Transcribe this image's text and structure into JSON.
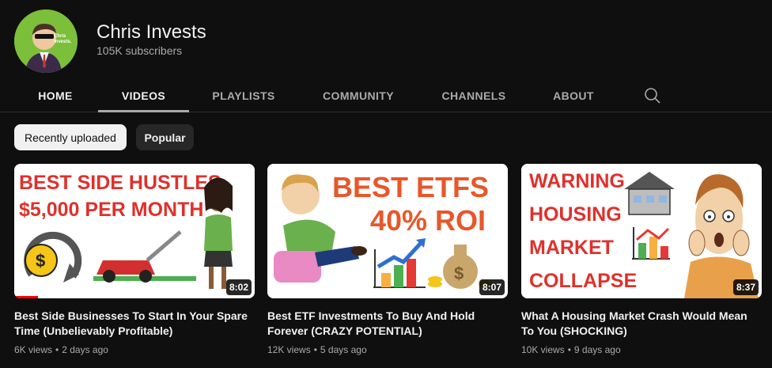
{
  "channel": {
    "name": "Chris Invests",
    "subscribers": "105K subscribers",
    "avatar_text": "Chris Invests."
  },
  "tabs": [
    {
      "label": "HOME"
    },
    {
      "label": "VIDEOS"
    },
    {
      "label": "PLAYLISTS"
    },
    {
      "label": "COMMUNITY"
    },
    {
      "label": "CHANNELS"
    },
    {
      "label": "ABOUT"
    }
  ],
  "active_tab": "VIDEOS",
  "chips": {
    "recent": "Recently uploaded",
    "popular": "Popular",
    "selected": "Recently uploaded"
  },
  "videos": [
    {
      "title": "Best Side Businesses To Start In Your Spare Time (Unbelievably Profitable)",
      "views": "6K views",
      "age": "2 days ago",
      "duration": "8:02",
      "watched_fraction": 0.1,
      "thumb_text": [
        "BEST SIDE HUSTLES",
        "$5,000 PER MONTH"
      ]
    },
    {
      "title": "Best ETF Investments To Buy And Hold Forever (CRAZY POTENTIAL)",
      "views": "12K views",
      "age": "5 days ago",
      "duration": "8:07",
      "watched_fraction": 0,
      "thumb_text": [
        "BEST ETFS",
        "40% ROI"
      ]
    },
    {
      "title": "What A Housing Market Crash Would Mean To You (SHOCKING)",
      "views": "10K views",
      "age": "9 days ago",
      "duration": "8:37",
      "watched_fraction": 0,
      "thumb_text": [
        "WARNING",
        "HOUSING",
        "MARKET",
        "COLLAPSE"
      ]
    }
  ],
  "colors": {
    "background": "#0f0f0f",
    "thumb_text_red": "#e0302b",
    "thumb_text_orange": "#e8572a",
    "progress": "#ff0000"
  }
}
